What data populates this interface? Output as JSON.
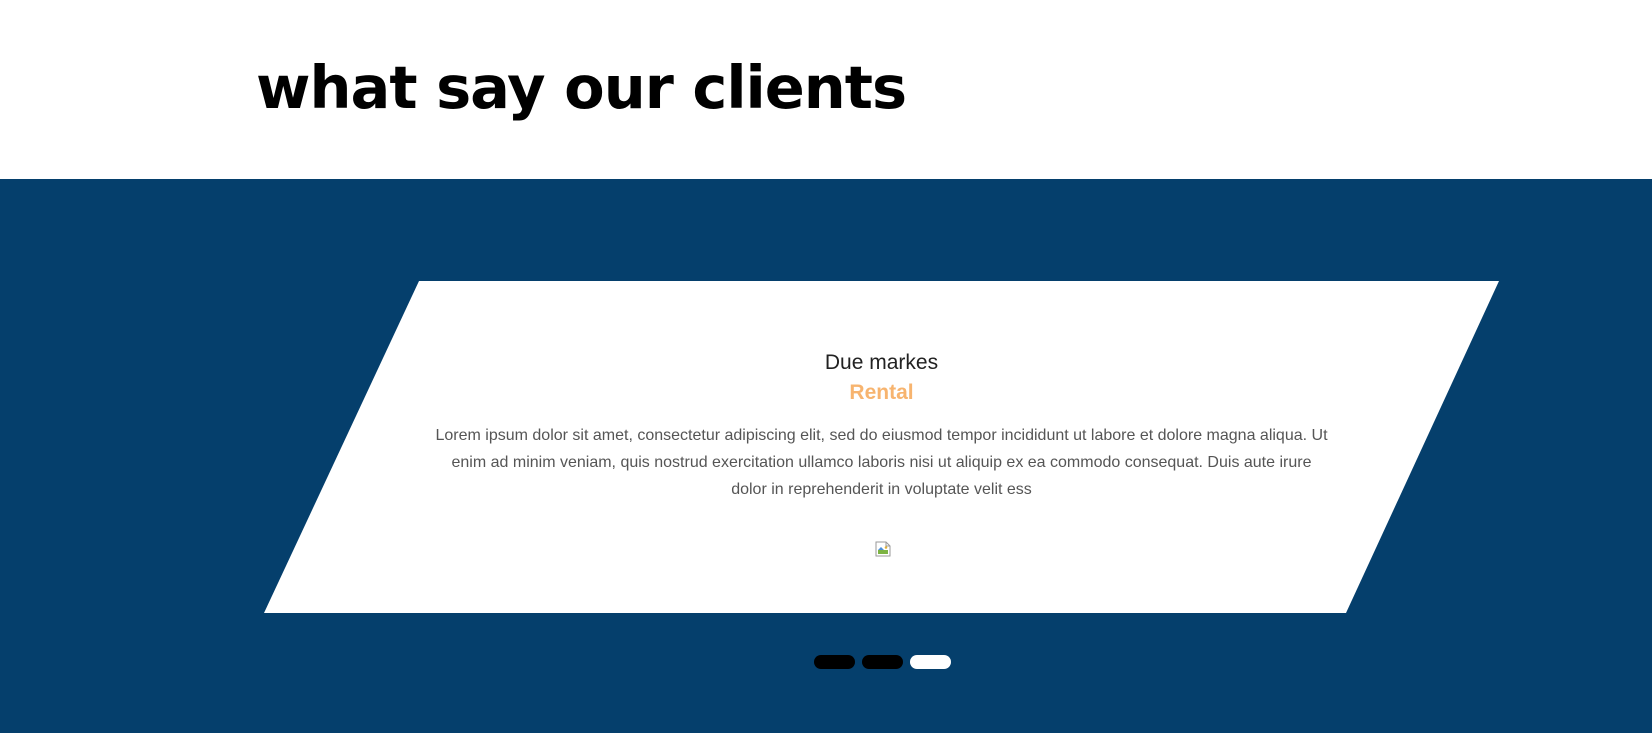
{
  "section": {
    "title": "what say our clients"
  },
  "colors": {
    "band_background": "#053f6c",
    "card_background": "#ffffff",
    "role_accent": "#f7b46f",
    "dot_inactive": "#000000",
    "dot_active": "#ffffff"
  },
  "testimonial": {
    "name": "Due markes",
    "role": "Rental",
    "quote": "Lorem ipsum dolor sit amet, consectetur adipiscing elit, sed do eiusmod tempor incididunt ut labore et dolore magna aliqua. Ut enim ad minim veniam, quis nostrud exercitation ullamco laboris nisi ut aliquip ex ea commodo consequat. Duis aute irure dolor in reprehenderit in voluptate velit ess",
    "photo_icon": "broken-image-icon"
  },
  "carousel": {
    "slide_count": 3,
    "active_slide": 3
  }
}
